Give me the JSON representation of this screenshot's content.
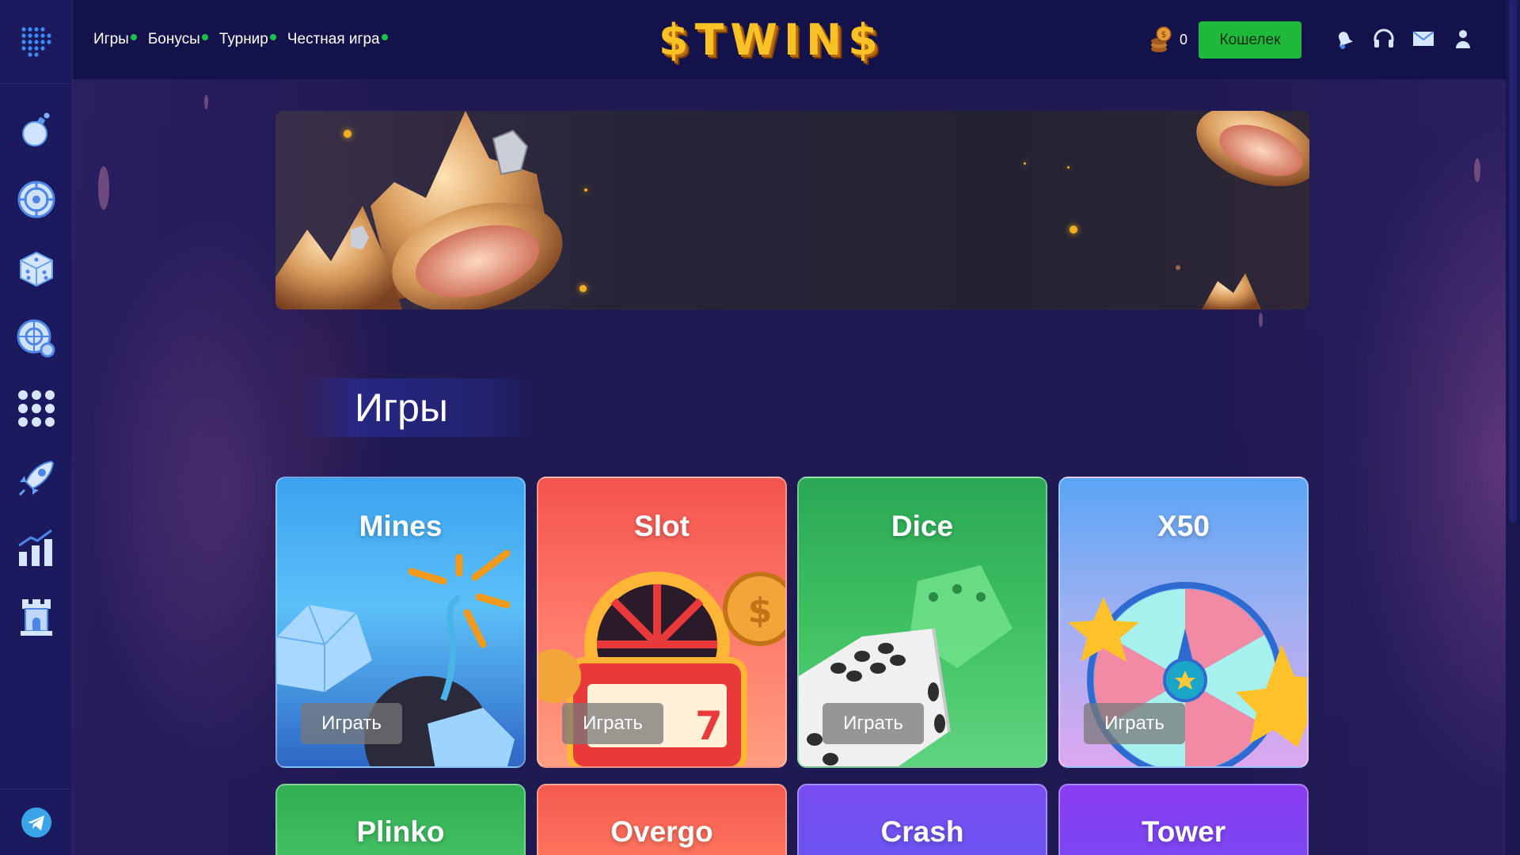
{
  "header": {
    "menu": [
      "Игры",
      "Бонусы",
      "Турнир",
      "Честная игра"
    ],
    "brand": "$TWIN$",
    "balance": "0",
    "wallet_label": "Кошелек"
  },
  "sidebar": {
    "items": [
      {
        "icon": "bomb-icon"
      },
      {
        "icon": "roulette-icon"
      },
      {
        "icon": "dice-icon"
      },
      {
        "icon": "wheel-settings-icon"
      },
      {
        "icon": "dots-grid-icon"
      },
      {
        "icon": "rocket-icon"
      },
      {
        "icon": "chart-bars-icon"
      },
      {
        "icon": "tower-icon"
      }
    ],
    "bottom_icon": "telegram-icon"
  },
  "section": {
    "title": "Игры"
  },
  "games": [
    {
      "title": "Mines",
      "play": "Играть",
      "color_top": "#3aa2ef",
      "color_bottom": "#2a6fd0"
    },
    {
      "title": "Slot",
      "play": "Играть",
      "color_top": "#f4594f",
      "color_bottom": "#ff8a70"
    },
    {
      "title": "Dice",
      "play": "Играть",
      "color_top": "#2eae58",
      "color_bottom": "#55d07a"
    },
    {
      "title": "X50",
      "play": "Играть",
      "color_top": "#6ea6f2",
      "color_bottom": "#d6a7f0"
    }
  ],
  "games_row2": [
    {
      "title": "Plinko",
      "color": "#2fae52"
    },
    {
      "title": "Overgo",
      "color": "#f25a4c"
    },
    {
      "title": "Crash",
      "color": "#7a4df0"
    },
    {
      "title": "Tower",
      "color": "#8a3cf0"
    }
  ]
}
